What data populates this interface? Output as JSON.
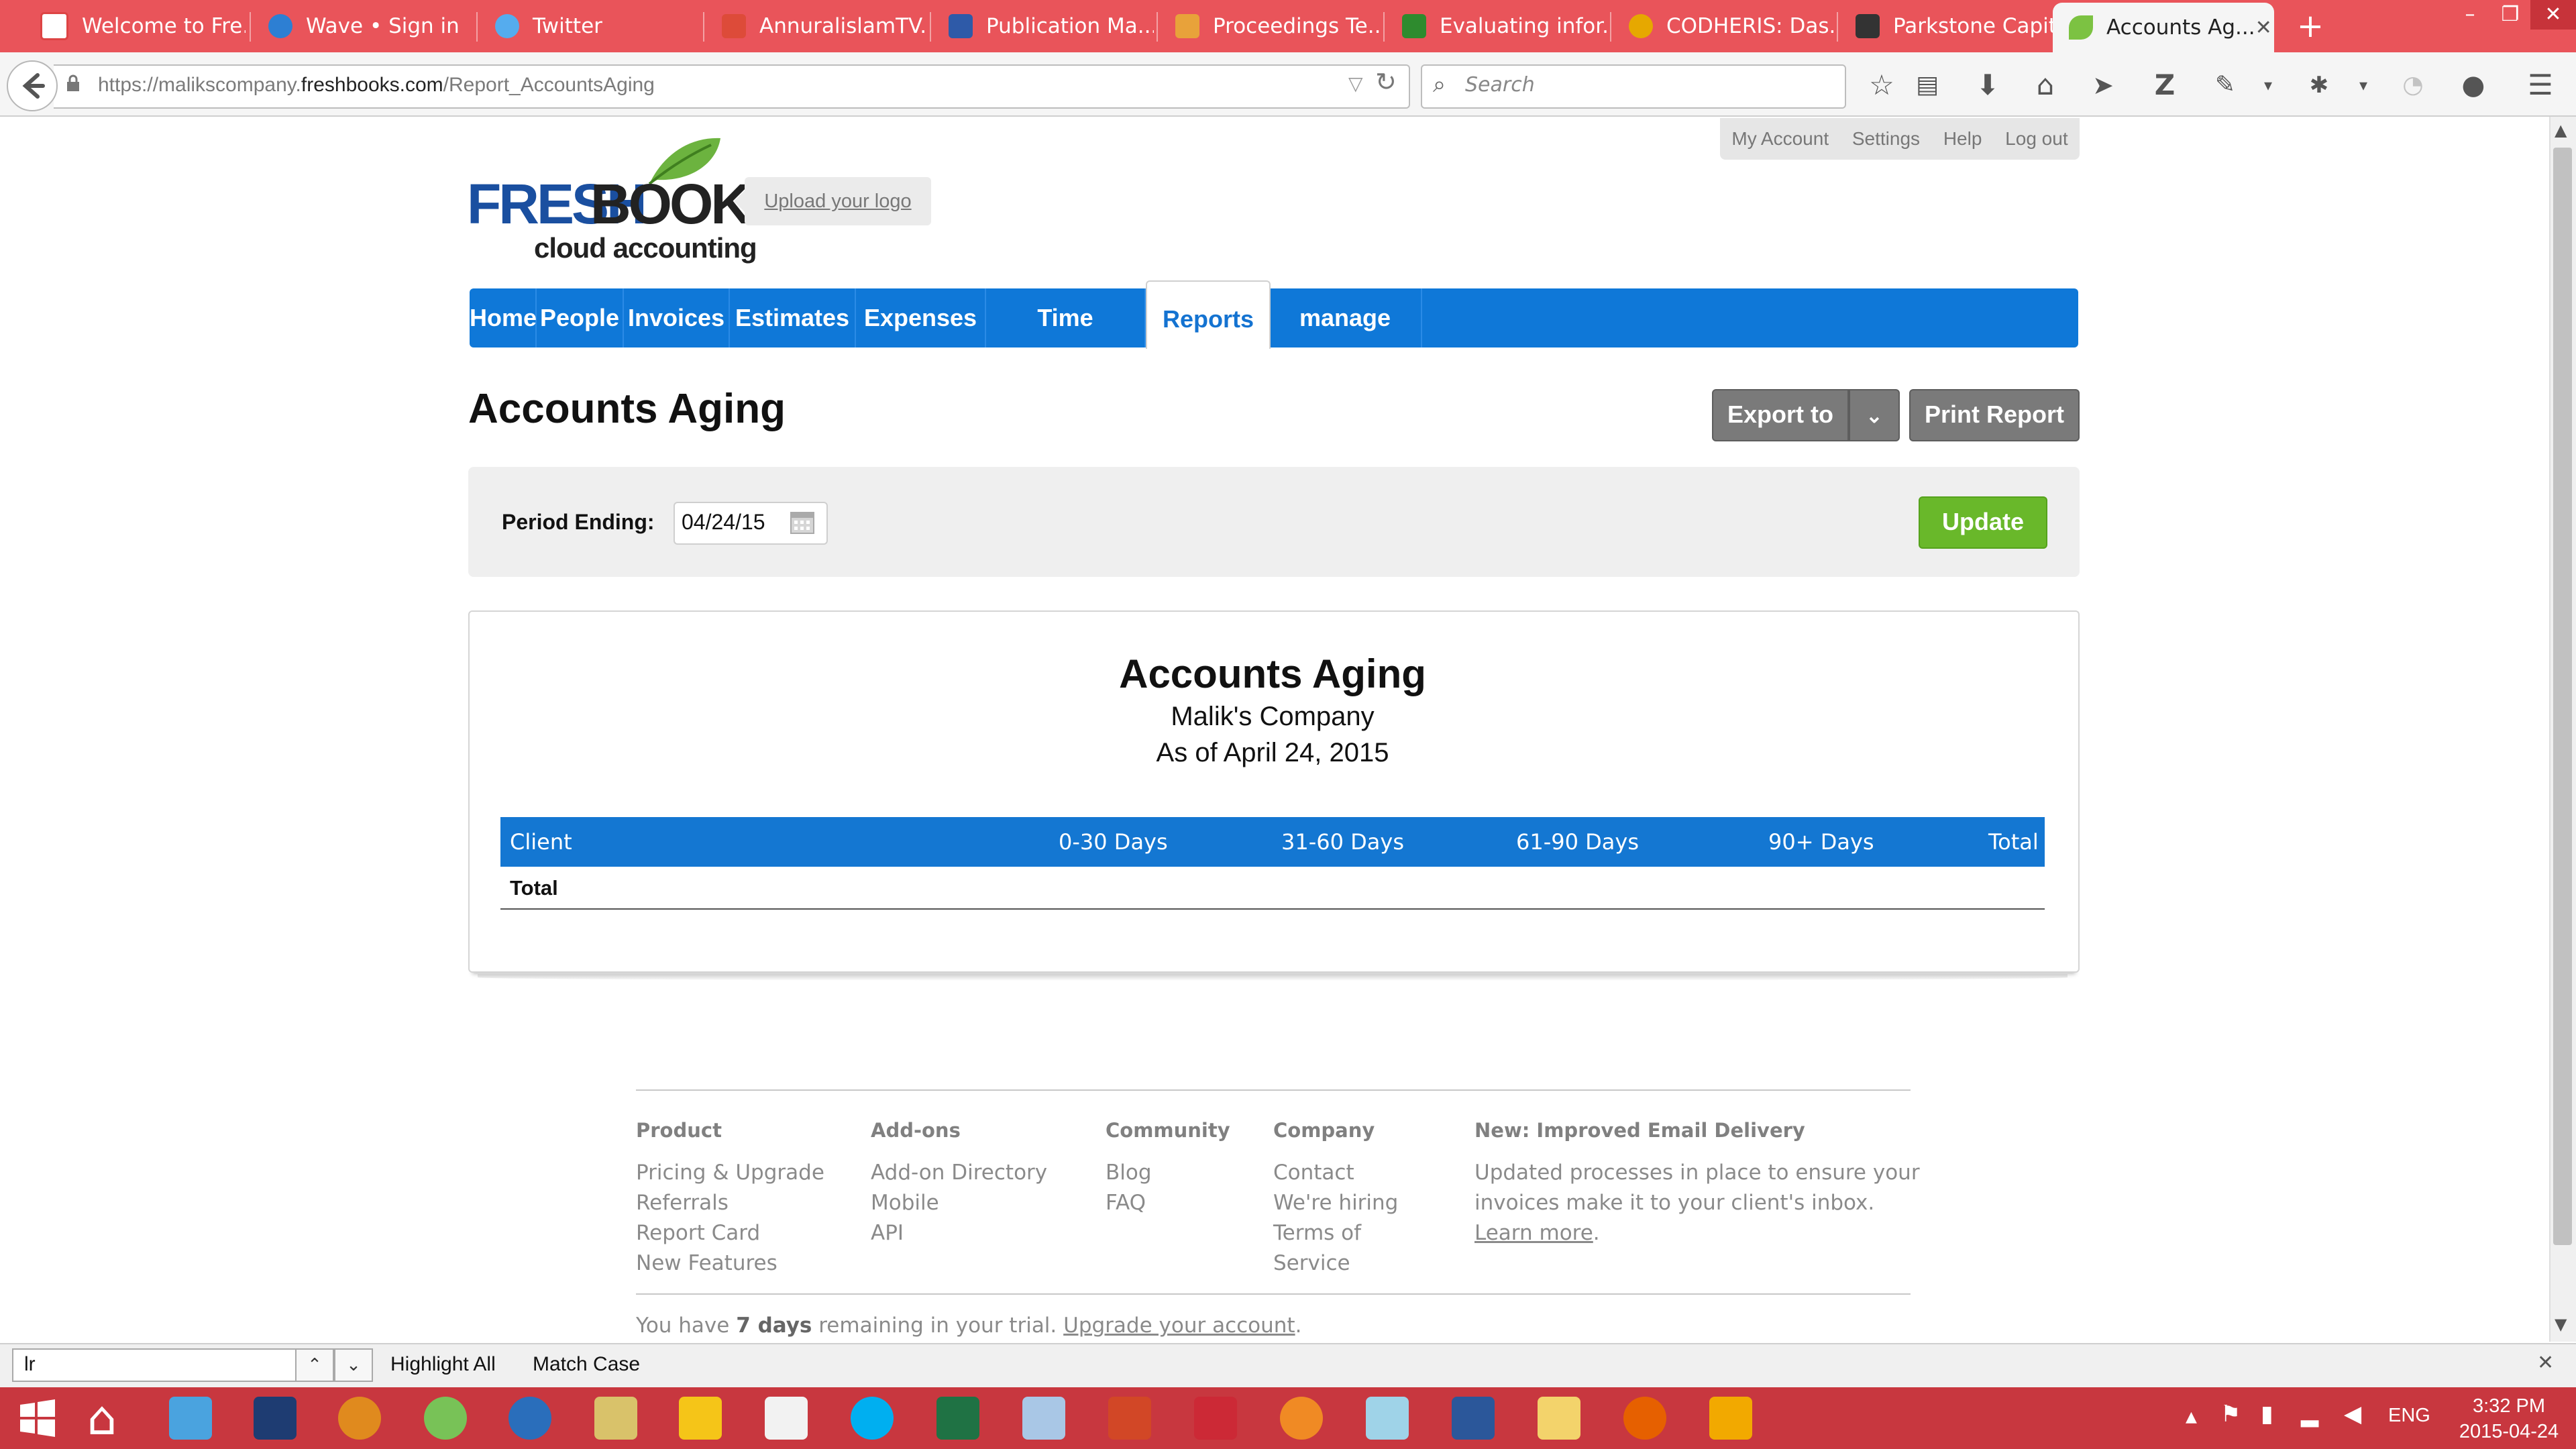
{
  "browser": {
    "tabs": [
      {
        "label": "Welcome to Fre...",
        "icon": "gmail-icon",
        "color": "#ffffff"
      },
      {
        "label": "Wave • Sign in",
        "icon": "wave-icon",
        "color": "#2d7fd3"
      },
      {
        "label": "Twitter",
        "icon": "twitter-icon",
        "color": "#55acee"
      },
      {
        "label": "AnnuralislamTV...",
        "icon": "googleplus-icon",
        "color": "#dd4b39"
      },
      {
        "label": "Publication Ma...",
        "icon": "publication-icon",
        "color": "#2e5aa8"
      },
      {
        "label": "Proceedings Te...",
        "icon": "proceedings-icon",
        "color": "#e8a23a"
      },
      {
        "label": "Evaluating infor...",
        "icon": "evaluating-icon",
        "color": "#2e8b2e"
      },
      {
        "label": "CODHERIS: Das...",
        "icon": "codheris-icon",
        "color": "#e6a800"
      },
      {
        "label": "Parkstone Capit...",
        "icon": "parkstone-icon",
        "color": "#333333"
      },
      {
        "label": "Accounts Ag...",
        "icon": "freshbooks-leaf-icon",
        "color": "#7cc242",
        "active": true
      }
    ],
    "url_prefix": "https://malikscompany.",
    "url_domain": "freshbooks.com",
    "url_path": "/Report_AccountsAging",
    "search_placeholder": "Search"
  },
  "page": {
    "top_menu": [
      "My Account",
      "Settings",
      "Help",
      "Log out"
    ],
    "logo_fresh": "FRESH",
    "logo_books": "BOOKS",
    "logo_sub": "cloud accounting",
    "upload_logo": "Upload your logo",
    "nav": [
      {
        "label": "Home"
      },
      {
        "label": "People"
      },
      {
        "label": "Invoices"
      },
      {
        "label": "Estimates"
      },
      {
        "label": "Expenses"
      },
      {
        "label": "Time Tracking"
      },
      {
        "label": "Reports",
        "active": true
      },
      {
        "label": "manage tabs..."
      }
    ],
    "title": "Accounts Aging",
    "export_label": "Export to",
    "print_label": "Print Report",
    "period_label": "Period Ending:",
    "period_value": "04/24/15",
    "update_label": "Update",
    "report": {
      "title": "Accounts Aging",
      "company": "Malik's Company",
      "as_of": "As of April 24, 2015",
      "columns": [
        "Client",
        "0-30 Days",
        "31-60 Days",
        "61-90 Days",
        "90+ Days",
        "Total"
      ],
      "total_label": "Total"
    },
    "footer": {
      "columns": [
        {
          "heading": "Product",
          "links": [
            "Pricing & Upgrade",
            "Referrals",
            "Report Card",
            "New Features"
          ]
        },
        {
          "heading": "Add-ons",
          "links": [
            "Add-on Directory",
            "Mobile",
            "API"
          ]
        },
        {
          "heading": "Community",
          "links": [
            "Blog",
            "FAQ"
          ]
        },
        {
          "heading": "Company",
          "links": [
            "Contact",
            "We're hiring",
            "Terms of",
            "Service"
          ]
        }
      ],
      "news_heading": "New: Improved Email Delivery",
      "news_line1": "Updated processes in place to ensure your",
      "news_line2": "invoices make it to your client's inbox.",
      "news_link": "Learn more",
      "trial_pre": "You have ",
      "trial_days": "7 days",
      "trial_mid": " remaining in your trial. ",
      "trial_link": "Upgrade your account",
      "trial_post": "."
    }
  },
  "findbar": {
    "value": "lr",
    "highlight_all": "Highlight All",
    "match_case": "Match Case"
  },
  "taskbar": {
    "apps": [
      "start-icon",
      "home-icon",
      "mail-icon",
      "lenovo-icon",
      "media-icon",
      "android-studio-icon",
      "r-icon",
      "paint-icon",
      "stickies-icon",
      "calendar-icon",
      "skype-icon",
      "excel-icon",
      "box-icon",
      "powerpoint-icon",
      "zotero-icon",
      "orange-app-icon",
      "notes-icon",
      "word-icon",
      "explorer-icon",
      "firefox-icon",
      "outlook-icon"
    ],
    "lang": "ENG",
    "time": "3:32 PM",
    "date": "2015-04-24"
  }
}
